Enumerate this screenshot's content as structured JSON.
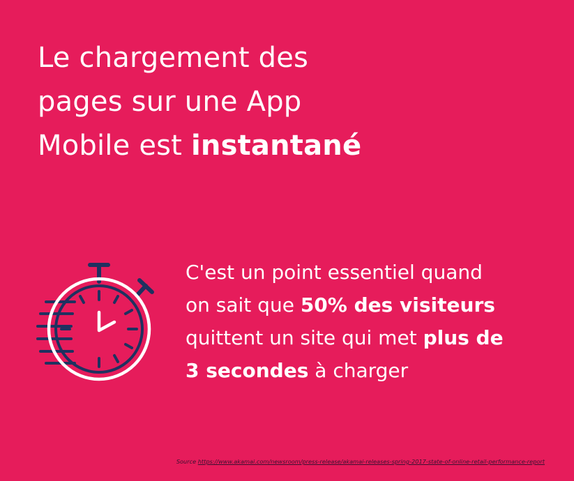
{
  "headline": {
    "line1": "Le chargement des",
    "line2": "pages sur une App",
    "line3_regular": "Mobile est ",
    "line3_bold": "instantané"
  },
  "body": {
    "line1": "C'est un point essentiel quand",
    "line2_regular": "on sait que ",
    "line2_bold": "50% des visiteurs",
    "line3_regular": "quittent un site qui met ",
    "line3_bold": "plus de",
    "line4_bold": "3 secondes",
    "line4_regular": " à charger"
  },
  "source": {
    "label": "Source",
    "url": "https://www.akamai.com/newsroom/press-release/akamai-releases-spring-2017-state-of-online-retail-performance-report"
  },
  "icon": "stopwatch-icon",
  "colors": {
    "background": "#E61C5B",
    "text": "#FFFFFF",
    "icon_navy": "#1F3160",
    "source_text": "#3A1030"
  }
}
